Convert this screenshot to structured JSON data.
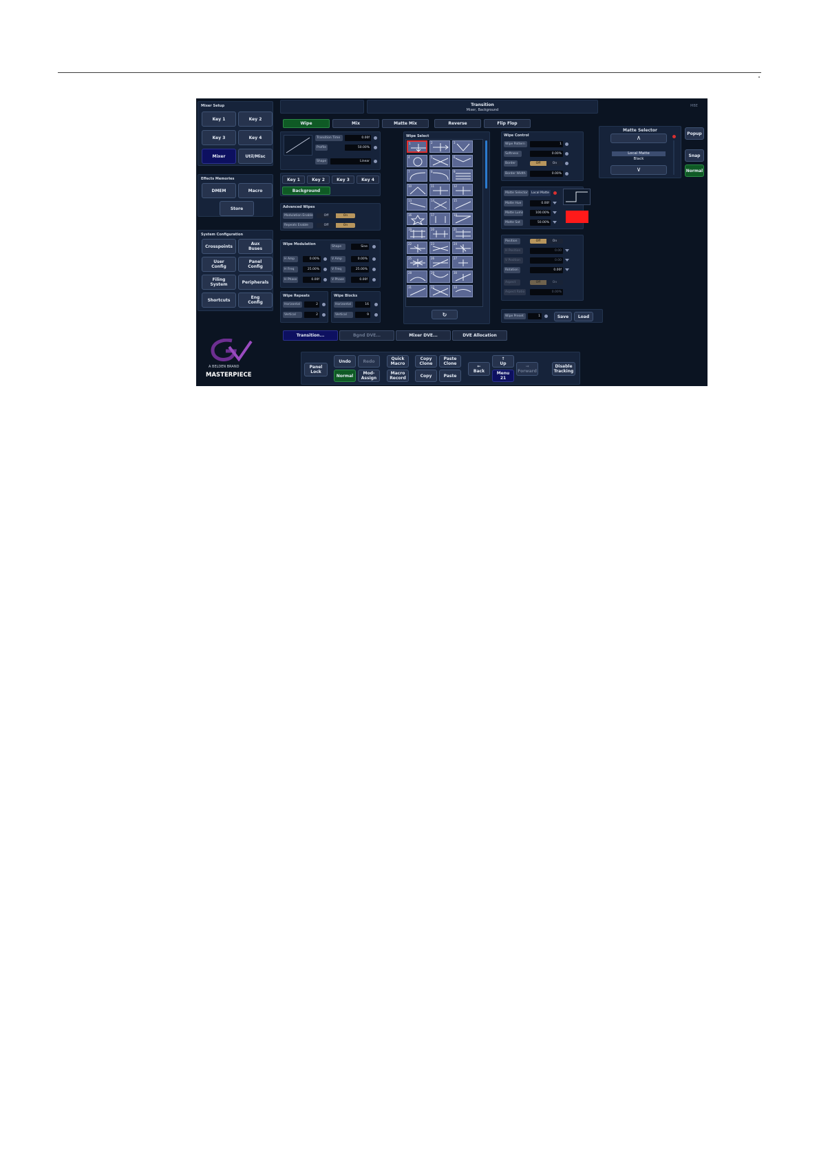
{
  "mixer_setup": {
    "title": "Mixer Setup",
    "buttons": [
      "Key 1",
      "Key 2",
      "Key 3",
      "Key 4",
      "Mixer",
      "Util/Misc"
    ]
  },
  "effects_memories": {
    "title": "Effects Memories",
    "dmem": "DMEM",
    "macro": "Macro",
    "store": "Store"
  },
  "system_configuration": {
    "title": "System Configuration",
    "buttons": [
      "Crosspoints",
      "Aux\nBuses",
      "User\nConfig",
      "Panel\nConfig",
      "Filing\nSystem",
      "Peripherals",
      "Shortcuts",
      "Eng\nConfig"
    ]
  },
  "brand": {
    "tagline": "A BELDEN BRAND",
    "product": "MASTERPIECE"
  },
  "header": {
    "title": "Transition",
    "subtitle": "Mixer, Background",
    "status": "MBE"
  },
  "transition_tabs": [
    "Wipe",
    "Mix",
    "Matte Mix",
    "Reverse",
    "Flip Flop"
  ],
  "transition_params": [
    {
      "label": "Transition Time",
      "value": "0.00f"
    },
    {
      "label": "Profile",
      "value": "50.00%"
    },
    {
      "label": "Shape",
      "value": "Linear"
    }
  ],
  "key_tabs": [
    "Key 1",
    "Key 2",
    "Key 3",
    "Key 4"
  ],
  "background_button": "Background",
  "advanced_wipes": {
    "title": "Advanced Wipes",
    "rows": [
      {
        "label": "Modulation Enable",
        "off": "Off",
        "on": "On"
      },
      {
        "label": "Repeats Enable",
        "off": "Off",
        "on": "On"
      }
    ]
  },
  "wipe_modulation": {
    "title": "Wipe Modulation",
    "shape_label": "Shape",
    "shape_value": "Sine",
    "rows": [
      {
        "label": "H Amp",
        "value": "0.00%"
      },
      {
        "label": "V Amp",
        "value": "0.00%"
      },
      {
        "label": "H Freq",
        "value": "25.00%"
      },
      {
        "label": "V Freq",
        "value": "25.00%"
      },
      {
        "label": "H Phase",
        "value": "0.00f"
      },
      {
        "label": "V Phase",
        "value": "0.00f"
      }
    ]
  },
  "wipe_repeats": {
    "title": "Wipe Repeats",
    "rows": [
      {
        "label": "Horizontal",
        "value": "2"
      },
      {
        "label": "Vertical",
        "value": "2"
      }
    ]
  },
  "wipe_blocks": {
    "title": "Wipe Blocks",
    "rows": [
      {
        "label": "Horizontal",
        "value": "16"
      },
      {
        "label": "Vertical",
        "value": "9"
      }
    ]
  },
  "wipe_select": {
    "title": "Wipe Select",
    "numbers": [
      "1",
      "2",
      "3",
      "4",
      "5",
      "6",
      "7",
      "8",
      "9",
      "10",
      "11",
      "12",
      "13",
      "14",
      "15",
      "16",
      "17",
      "18",
      "19",
      "20",
      "21",
      "22",
      "23",
      "24",
      "25",
      "26",
      "27",
      "28",
      "29",
      "30",
      "31",
      "32",
      "33"
    ]
  },
  "wipe_control": {
    "title": "Wipe Control",
    "rows": [
      {
        "label": "Wipe Pattern",
        "value": "1"
      },
      {
        "label": "Softness",
        "value": "0.00%"
      }
    ],
    "border_label": "Border",
    "border_off": "Off",
    "border_on": "On",
    "border_width_label": "Border Width",
    "border_width_value": "0.00%"
  },
  "matte": {
    "selector_label": "Matte Selector",
    "selector_value": "Local Matte",
    "rows": [
      {
        "label": "Matte Hue",
        "value": "0.00f"
      },
      {
        "label": "Matte Luma",
        "value": "100.00%"
      },
      {
        "label": "Matte Sat",
        "value": "50.00%"
      }
    ],
    "swatch_color": "#ff1a1a"
  },
  "position": {
    "label": "Position",
    "off": "Off",
    "on": "On",
    "rows": [
      {
        "label": "H Position",
        "value": "0.00"
      },
      {
        "label": "V Position",
        "value": "0.00"
      },
      {
        "label": "Rotation",
        "value": "0.00f"
      }
    ],
    "aspect_label": "Aspect",
    "aspect_off": "Off",
    "aspect_on": "On",
    "aspect_ratio_label": "Aspect Ratio",
    "aspect_ratio_value": "0.00%"
  },
  "wipe_preset": {
    "label": "Wipe Preset",
    "value": "1",
    "save": "Save",
    "load": "Load"
  },
  "matte_selector_panel": {
    "title": "Matte Selector",
    "line1": "Local Matte",
    "line2": "Black"
  },
  "right_buttons": [
    "Popup",
    "Snap",
    "Normal"
  ],
  "menu_tabs": [
    "Transition...",
    "Bgnd DVE...",
    "Mixer DVE...",
    "DVE Allocation"
  ],
  "bottom_bar": {
    "panel_lock": "Panel\nLock",
    "undo": "Undo",
    "redo": "Redo",
    "normal": "Normal",
    "mod_assign": "Mod-\nAssign",
    "quick_macro": "Quick\nMacro",
    "macro_record": "Macro\nRecord",
    "copy_clone": "Copy\nClone",
    "paste_clone": "Paste\nClone",
    "copy": "Copy",
    "paste": "Paste",
    "back": "Back",
    "up": "Up",
    "menu": "Menu\n21",
    "forward": "Forward",
    "disable_tracking": "Disable\nTracking"
  },
  "colors": {
    "background": "#0b1422",
    "panel": "#16233a",
    "accent_green": "#0f5a25",
    "accent_navy": "#0d1060",
    "toggle_on": "#b8965d",
    "selected_wipe": "#e03030"
  }
}
